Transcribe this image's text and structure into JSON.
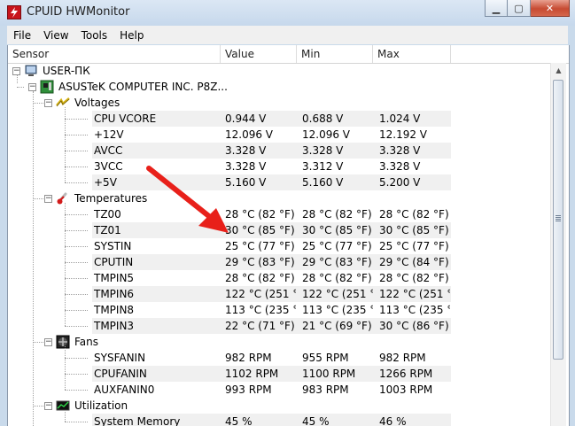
{
  "window": {
    "title": "CPUID HWMonitor",
    "minimize": "▁",
    "maximize": "▢",
    "close": "✕"
  },
  "menu": [
    "File",
    "View",
    "Tools",
    "Help"
  ],
  "columns": {
    "sensor": "Sensor",
    "value": "Value",
    "min": "Min",
    "max": "Max"
  },
  "tree": {
    "root": "USER-ПК",
    "board": "ASUSTeK COMPUTER INC. P8Z...",
    "groups": [
      {
        "label": "Voltages",
        "icon": "voltage-icon",
        "rows": [
          {
            "name": "CPU VCORE",
            "value": "0.944 V",
            "min": "0.688 V",
            "max": "1.024 V"
          },
          {
            "name": "+12V",
            "value": "12.096 V",
            "min": "12.096 V",
            "max": "12.192 V"
          },
          {
            "name": "AVCC",
            "value": "3.328 V",
            "min": "3.328 V",
            "max": "3.328 V"
          },
          {
            "name": "3VCC",
            "value": "3.328 V",
            "min": "3.312 V",
            "max": "3.328 V"
          },
          {
            "name": "+5V",
            "value": "5.160 V",
            "min": "5.160 V",
            "max": "5.200 V"
          }
        ]
      },
      {
        "label": "Temperatures",
        "icon": "thermometer-icon",
        "rows": [
          {
            "name": "TZ00",
            "value": "28 °C  (82 °F)",
            "min": "28 °C  (82 °F)",
            "max": "28 °C  (82 °F)"
          },
          {
            "name": "TZ01",
            "value": "30 °C  (85 °F)",
            "min": "30 °C  (85 °F)",
            "max": "30 °C  (85 °F)"
          },
          {
            "name": "SYSTIN",
            "value": "25 °C  (77 °F)",
            "min": "25 °C  (77 °F)",
            "max": "25 °C  (77 °F)"
          },
          {
            "name": "CPUTIN",
            "value": "29 °C  (83 °F)",
            "min": "29 °C  (83 °F)",
            "max": "29 °C  (84 °F)"
          },
          {
            "name": "TMPIN5",
            "value": "28 °C  (82 °F)",
            "min": "28 °C  (82 °F)",
            "max": "28 °C  (82 °F)"
          },
          {
            "name": "TMPIN6",
            "value": "122 °C  (251 °...",
            "min": "122 °C  (251 °...",
            "max": "122 °C  (251 °..."
          },
          {
            "name": "TMPIN8",
            "value": "113 °C  (235 °...",
            "min": "113 °C  (235 °...",
            "max": "113 °C  (235 °..."
          },
          {
            "name": "TMPIN3",
            "value": "22 °C  (71 °F)",
            "min": "21 °C  (69 °F)",
            "max": "30 °C  (86 °F)"
          }
        ]
      },
      {
        "label": "Fans",
        "icon": "fan-icon",
        "rows": [
          {
            "name": "SYSFANIN",
            "value": "982 RPM",
            "min": "955 RPM",
            "max": "982 RPM"
          },
          {
            "name": "CPUFANIN",
            "value": "1102 RPM",
            "min": "1100 RPM",
            "max": "1266 RPM"
          },
          {
            "name": "AUXFANIN0",
            "value": "993 RPM",
            "min": "983 RPM",
            "max": "1003 RPM"
          }
        ]
      },
      {
        "label": "Utilization",
        "icon": "utilization-icon",
        "rows": [
          {
            "name": "System Memory",
            "value": "45 %",
            "min": "45 %",
            "max": "46 %"
          }
        ]
      }
    ]
  },
  "colors": {
    "arrow": "#e8201a",
    "title_bg": "#c9daeb",
    "row_shade": "#f0f0f0"
  }
}
